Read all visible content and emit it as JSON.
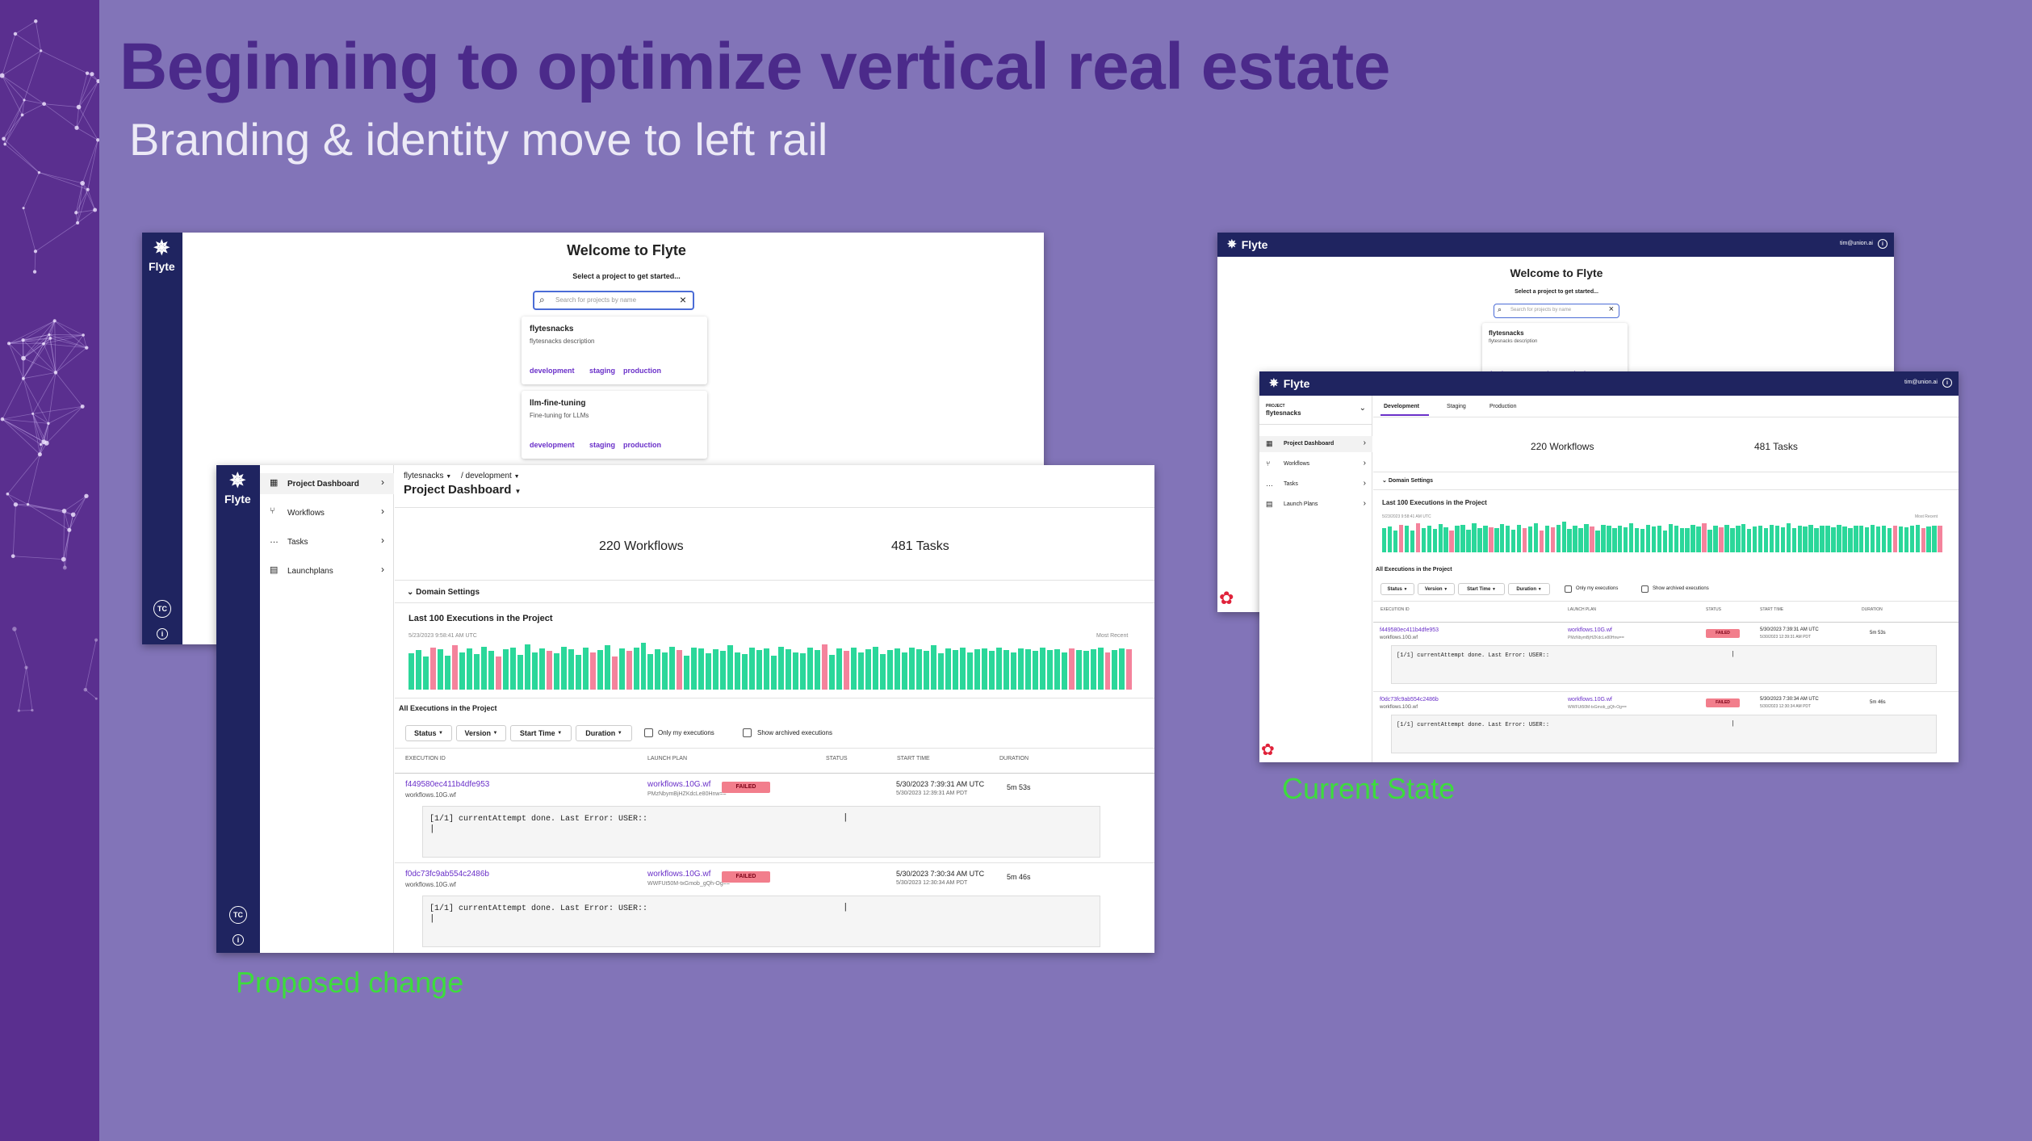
{
  "slide": {
    "title": "Beginning to optimize vertical real estate",
    "subtitle": "Branding & identity move to left rail",
    "caption_proposed": "Proposed change",
    "caption_current": "Current State"
  },
  "brand": {
    "name": "Flyte"
  },
  "user": {
    "initials": "TC",
    "email": "tim@union.ai"
  },
  "welcome": {
    "title": "Welcome to Flyte",
    "prompt": "Select a project to get started...",
    "search_placeholder": "Search for projects by name",
    "projects": [
      {
        "name": "flytesnacks",
        "description": "flytesnacks description",
        "domains": [
          "development",
          "staging",
          "production"
        ]
      },
      {
        "name": "llm-fine-tuning",
        "description": "Fine-tuning for LLMs",
        "domains": [
          "development",
          "staging",
          "production"
        ]
      }
    ]
  },
  "proposed": {
    "breadcrumb_project": "flytesnacks",
    "breadcrumb_domain": "/ development",
    "page_title": "Project Dashboard",
    "nav": [
      "Project Dashboard",
      "Workflows",
      "Tasks",
      "Launchplans"
    ]
  },
  "current": {
    "project_label": "PROJECT",
    "project_name": "flytesnacks",
    "tabs": [
      "Development",
      "Staging",
      "Production"
    ],
    "nav": [
      "Project Dashboard",
      "Workflows",
      "Tasks",
      "Launch Plans"
    ]
  },
  "dashboard": {
    "workflows": "220 Workflows",
    "tasks": "481 Tasks",
    "domain_settings": "Domain Settings",
    "chart_title": "Last 100 Executions in the Project",
    "chart_start": "5/23/2023 9:58:41 AM UTC",
    "chart_end": "Most Recent",
    "all_executions": "All Executions in the Project",
    "filters": [
      "Status",
      "Version",
      "Start Time",
      "Duration"
    ],
    "only_mine": "Only my executions",
    "show_archived": "Show archived executions",
    "columns": [
      "EXECUTION ID",
      "LAUNCH PLAN",
      "STATUS",
      "START TIME",
      "DURATION"
    ],
    "executions": [
      {
        "id": "f449580ec411b4dfe953",
        "workflow": "workflows.10G.wf",
        "launch_plan": "workflows.10G.wf",
        "lp_version": "PMzNbymBjHZKdcLe80Hnw==",
        "status": "FAILED",
        "start_utc": "5/30/2023 7:39:31 AM UTC",
        "start_local": "5/30/2023 12:39:31 AM PDT",
        "duration": "5m 53s",
        "log": "[1/1] currentAttempt done. Last Error: USER::"
      },
      {
        "id": "f0dc73fc9ab554c2486b",
        "workflow": "workflows.10G.wf",
        "launch_plan": "workflows.10G.wf",
        "lp_version": "WWFUt50M-txGmob_gQh-Og==",
        "status": "FAILED",
        "start_utc": "5/30/2023 7:30:34 AM UTC",
        "start_local": "5/30/2023 12:30:34 AM PDT",
        "duration": "5m 46s",
        "log": "[1/1] currentAttempt done. Last Error: USER::"
      }
    ]
  },
  "chart_data": {
    "type": "bar",
    "title": "Last 100 Executions in the Project",
    "x_start_label": "5/23/2023 9:58:41 AM UTC",
    "x_end_label": "Most Recent",
    "series_colors": {
      "succeeded": "#2bd79a",
      "failed": "#f4839c"
    },
    "values": [
      0.78,
      0.84,
      0.7,
      0.9,
      0.86,
      0.72,
      0.94,
      0.8,
      0.88,
      0.76,
      0.92,
      0.82,
      0.7,
      0.86,
      0.9,
      0.74,
      0.96,
      0.8,
      0.88,
      0.82,
      0.78,
      0.92,
      0.86,
      0.74,
      0.9,
      0.8,
      0.84,
      0.94,
      0.7,
      0.88,
      0.82,
      0.9,
      1.0,
      0.76,
      0.86,
      0.8,
      0.92,
      0.84,
      0.72,
      0.9,
      0.88,
      0.78,
      0.86,
      0.82,
      0.94,
      0.8,
      0.76,
      0.9,
      0.84,
      0.88,
      0.72,
      0.92,
      0.86,
      0.8,
      0.78,
      0.9,
      0.84,
      0.96,
      0.74,
      0.88,
      0.82,
      0.9,
      0.8,
      0.86,
      0.92,
      0.76,
      0.84,
      0.88,
      0.8,
      0.9,
      0.86,
      0.82,
      0.94,
      0.78,
      0.88,
      0.84,
      0.9,
      0.8,
      0.86,
      0.88,
      0.82,
      0.9,
      0.84,
      0.8,
      0.88,
      0.86,
      0.82,
      0.9,
      0.84,
      0.86,
      0.8,
      0.88,
      0.84,
      0.82,
      0.86,
      0.9,
      0.8,
      0.84,
      0.88,
      0.86
    ],
    "status": [
      "s",
      "s",
      "s",
      "f",
      "s",
      "s",
      "f",
      "s",
      "s",
      "s",
      "s",
      "s",
      "f",
      "s",
      "s",
      "s",
      "s",
      "s",
      "s",
      "f",
      "s",
      "s",
      "s",
      "s",
      "s",
      "f",
      "s",
      "s",
      "f",
      "s",
      "f",
      "s",
      "s",
      "s",
      "s",
      "s",
      "s",
      "f",
      "s",
      "s",
      "s",
      "s",
      "s",
      "s",
      "s",
      "s",
      "s",
      "s",
      "s",
      "s",
      "s",
      "s",
      "s",
      "s",
      "s",
      "s",
      "s",
      "f",
      "s",
      "s",
      "f",
      "s",
      "s",
      "s",
      "s",
      "s",
      "s",
      "s",
      "s",
      "s",
      "s",
      "s",
      "s",
      "s",
      "s",
      "s",
      "s",
      "s",
      "s",
      "s",
      "s",
      "s",
      "s",
      "s",
      "s",
      "s",
      "s",
      "s",
      "s",
      "s",
      "s",
      "f",
      "s",
      "s",
      "s",
      "s",
      "f",
      "s",
      "s",
      "f"
    ]
  }
}
